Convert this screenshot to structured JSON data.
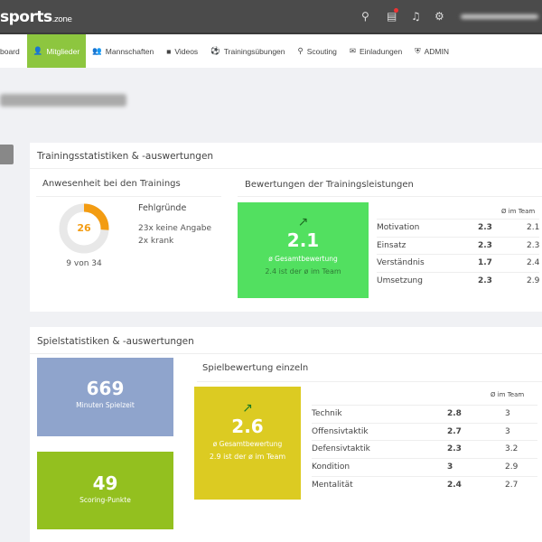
{
  "header": {
    "logo": "sports",
    "logo_suffix": ".zone",
    "icons": [
      "search-icon",
      "calendar-icon",
      "bell-icon",
      "gear-icon"
    ]
  },
  "nav": [
    {
      "label": "board",
      "icon": ""
    },
    {
      "label": "Mitglieder",
      "icon": "👤"
    },
    {
      "label": "Mannschaften",
      "icon": "👥"
    },
    {
      "label": "Videos",
      "icon": "■"
    },
    {
      "label": "Trainingsübungen",
      "icon": "⚽"
    },
    {
      "label": "Scouting",
      "icon": "⚲"
    },
    {
      "label": "Einladungen",
      "icon": "✉"
    },
    {
      "label": "ADMIN",
      "icon": "⛨"
    }
  ],
  "training": {
    "title": "Trainingsstatistiken & -auswertungen",
    "attendance": {
      "title": "Anwesenheit bei den Trainings",
      "percent": "26",
      "percent_fraction": 0.26,
      "count": "9 von 34",
      "reasons_title": "Fehlgründe",
      "reasons": [
        "23x keine Angabe",
        "2x krank"
      ]
    },
    "ratings": {
      "title": "Bewertungen der Trainingsleistungen",
      "score": "2.1",
      "score_label": "ø Gesamtbewertung",
      "team_note": "2.4 ist der ø im Team",
      "team_header": "Ø im Team",
      "rows": [
        {
          "name": "Motivation",
          "value": "2.3",
          "team": "2.1"
        },
        {
          "name": "Einsatz",
          "value": "2.3",
          "team": "2.3"
        },
        {
          "name": "Verständnis",
          "value": "1.7",
          "team": "2.4"
        },
        {
          "name": "Umsetzung",
          "value": "2.3",
          "team": "2.9"
        }
      ]
    }
  },
  "game": {
    "title": "Spielstatistiken & -auswertungen",
    "minutes": {
      "value": "669",
      "label": "Minuten Spielzeit"
    },
    "points": {
      "value": "49",
      "label": "Scoring-Punkte"
    },
    "rating": {
      "title": "Spielbewertung einzeln",
      "score": "2.6",
      "score_label": "ø Gesamtbewertung",
      "team_note": "2.9 ist der ø im Team",
      "team_header": "Ø im Team",
      "rows": [
        {
          "name": "Technik",
          "value": "2.8",
          "team": "3"
        },
        {
          "name": "Offensivtaktik",
          "value": "2.7",
          "team": "3"
        },
        {
          "name": "Defensivtaktik",
          "value": "2.3",
          "team": "3.2"
        },
        {
          "name": "Kondition",
          "value": "3",
          "team": "2.9"
        },
        {
          "name": "Mentalität",
          "value": "2.4",
          "team": "2.7"
        }
      ]
    }
  },
  "colors": {
    "green": "#8dc63f",
    "rating_green": "#52e060",
    "yellow": "#dccb22",
    "blue": "#8fa4cc",
    "lime": "#93c01f",
    "orange": "#f39c12"
  }
}
